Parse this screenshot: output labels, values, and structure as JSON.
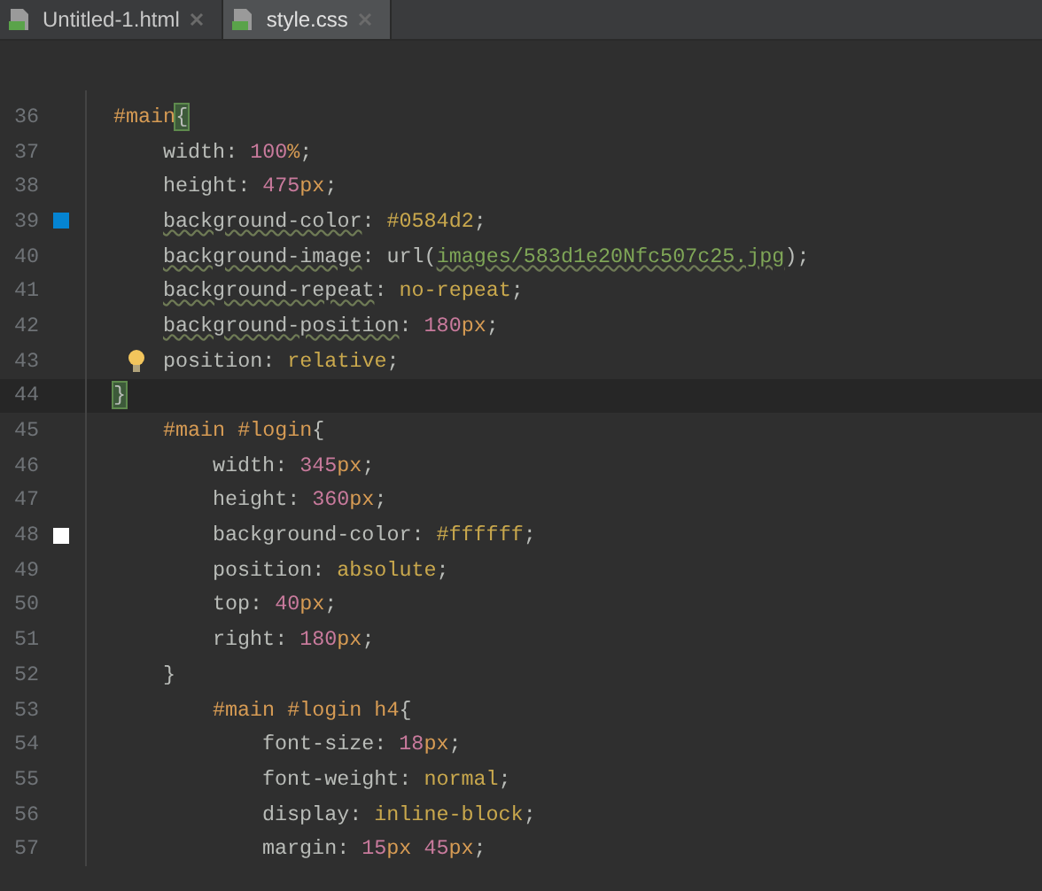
{
  "tabs": [
    {
      "label": "Untitled-1.html",
      "selected": false
    },
    {
      "label": "style.css",
      "selected": true
    }
  ],
  "rules": [
    {
      "number": "36",
      "selector": "#main",
      "brace_open": "{",
      "brace_close": "}",
      "close_number": "44",
      "current": true,
      "declarations": [
        {
          "number": "37",
          "property": "width",
          "value": [
            {
              "kind": "number",
              "text": "100"
            },
            {
              "kind": "unit",
              "text": "%"
            }
          ]
        },
        {
          "number": "38",
          "property": "height",
          "value": [
            {
              "kind": "number",
              "text": "475"
            },
            {
              "kind": "unit",
              "text": "px"
            }
          ]
        },
        {
          "number": "39",
          "property": "background-color",
          "warning": true,
          "color": "#0584d2",
          "value": [
            {
              "kind": "keyword",
              "text": "#0584d2"
            }
          ]
        },
        {
          "number": "40",
          "property": "background-image",
          "warning": true,
          "value": [
            {
              "kind": "plain",
              "text": "url("
            },
            {
              "kind": "string",
              "text": "images/583d1e20Nfc507c25.jpg"
            },
            {
              "kind": "plain",
              "text": ")"
            }
          ]
        },
        {
          "number": "41",
          "property": "background-repeat",
          "warning": true,
          "value": [
            {
              "kind": "keyword",
              "text": "no-repeat"
            }
          ]
        },
        {
          "number": "42",
          "property": "background-position",
          "warning": true,
          "value": [
            {
              "kind": "number",
              "text": "180"
            },
            {
              "kind": "unit",
              "text": "px"
            }
          ]
        },
        {
          "number": "43",
          "property": "position",
          "bulb": true,
          "value": [
            {
              "kind": "keyword",
              "text": "relative"
            }
          ]
        }
      ],
      "children": [
        {
          "number": "45",
          "selector": "#main #login",
          "brace_open": "{",
          "brace_close": "}",
          "close_number": "52",
          "current": false,
          "declarations": [
            {
              "number": "46",
              "property": "width",
              "value": [
                {
                  "kind": "number",
                  "text": "345"
                },
                {
                  "kind": "unit",
                  "text": "px"
                }
              ]
            },
            {
              "number": "47",
              "property": "height",
              "value": [
                {
                  "kind": "number",
                  "text": "360"
                },
                {
                  "kind": "unit",
                  "text": "px"
                }
              ]
            },
            {
              "number": "48",
              "property": "background-color",
              "color": "#ffffff",
              "value": [
                {
                  "kind": "keyword",
                  "text": "#ffffff"
                }
              ]
            },
            {
              "number": "49",
              "property": "position",
              "value": [
                {
                  "kind": "keyword",
                  "text": "absolute"
                }
              ]
            },
            {
              "number": "50",
              "property": "top",
              "value": [
                {
                  "kind": "number",
                  "text": "40"
                },
                {
                  "kind": "unit",
                  "text": "px"
                }
              ]
            },
            {
              "number": "51",
              "property": "right",
              "value": [
                {
                  "kind": "number",
                  "text": "180"
                },
                {
                  "kind": "unit",
                  "text": "px"
                }
              ]
            }
          ],
          "children": [
            {
              "number": "53",
              "selector": "#main #login h4",
              "brace_open": "{",
              "current": false,
              "declarations": [
                {
                  "number": "54",
                  "property": "font-size",
                  "value": [
                    {
                      "kind": "number",
                      "text": "18"
                    },
                    {
                      "kind": "unit",
                      "text": "px"
                    }
                  ]
                },
                {
                  "number": "55",
                  "property": "font-weight",
                  "value": [
                    {
                      "kind": "keyword",
                      "text": "normal"
                    }
                  ]
                },
                {
                  "number": "56",
                  "property": "display",
                  "value": [
                    {
                      "kind": "keyword",
                      "text": "inline-block"
                    }
                  ]
                },
                {
                  "number": "57",
                  "property": "margin",
                  "value": [
                    {
                      "kind": "number",
                      "text": "15"
                    },
                    {
                      "kind": "unit",
                      "text": "px"
                    },
                    {
                      "kind": "number",
                      "text": "45"
                    },
                    {
                      "kind": "unit",
                      "text": "px"
                    }
                  ]
                }
              ]
            }
          ]
        }
      ]
    }
  ],
  "colon": ":",
  "semicolon": ";"
}
